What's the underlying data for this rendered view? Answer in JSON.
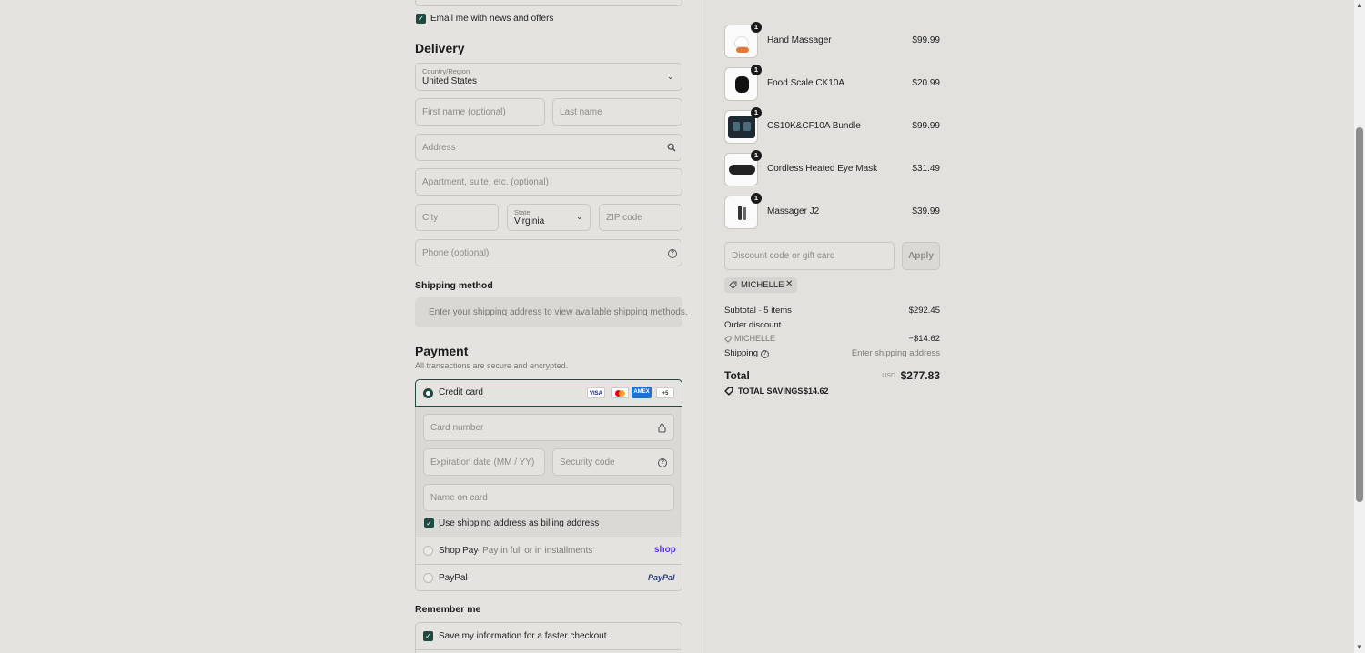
{
  "marketing": {
    "email_optin_label": "Email me with news and offers"
  },
  "delivery": {
    "title": "Delivery",
    "country_label": "Country/Region",
    "country_value": "United States",
    "first_name_placeholder": "First name (optional)",
    "last_name_placeholder": "Last name",
    "address_placeholder": "Address",
    "apartment_placeholder": "Apartment, suite, etc. (optional)",
    "city_placeholder": "City",
    "state_label": "State",
    "state_value": "Virginia",
    "zip_placeholder": "ZIP code",
    "phone_placeholder": "Phone (optional)"
  },
  "shipping": {
    "title": "Shipping method",
    "notice": "Enter your shipping address to view available shipping methods."
  },
  "payment": {
    "title": "Payment",
    "subtitle": "All transactions are secure and encrypted.",
    "credit_card_label": "Credit card",
    "card_logos": [
      "VISA",
      "MC",
      "AMEX",
      "+5"
    ],
    "card_number_placeholder": "Card number",
    "expiration_placeholder": "Expiration date (MM / YY)",
    "security_code_placeholder": "Security code",
    "name_on_card_placeholder": "Name on card",
    "billing_same_label": "Use shipping address as billing address",
    "shop_pay_label": "Shop Pay",
    "shop_pay_sub": "· Pay in full or in installments",
    "shop_pay_logo": "shop",
    "paypal_label": "PayPal",
    "paypal_logo": "PayPal"
  },
  "remember": {
    "title": "Remember me",
    "save_info_label": "Save my information for a faster checkout"
  },
  "cart": {
    "items": [
      {
        "name": "Hand Massager",
        "qty": "1",
        "price": "$99.99"
      },
      {
        "name": "Food Scale CK10A",
        "qty": "1",
        "price": "$20.99"
      },
      {
        "name": "CS10K&CF10A Bundle",
        "qty": "1",
        "price": "$99.99"
      },
      {
        "name": "Cordless Heated Eye Mask",
        "qty": "1",
        "price": "$31.49"
      },
      {
        "name": "Massager J2",
        "qty": "1",
        "price": "$39.99"
      }
    ],
    "discount_placeholder": "Discount code or gift card",
    "apply_label": "Apply",
    "applied_code": "MICHELLE"
  },
  "summary": {
    "subtotal_label": "Subtotal · 5 items",
    "subtotal_value": "$292.45",
    "order_discount_label": "Order discount",
    "discount_code": "MICHELLE",
    "discount_value": "−$14.62",
    "shipping_label": "Shipping",
    "shipping_value": "Enter shipping address",
    "total_label": "Total",
    "currency": "USD",
    "total_value": "$277.83",
    "savings_label": "TOTAL SAVINGS",
    "savings_value": "$14.62"
  },
  "colors": {
    "accent": "#1e4a40",
    "background": "#e4e3df",
    "shop_pay": "#5a31f4",
    "paypal": "#253b80"
  }
}
